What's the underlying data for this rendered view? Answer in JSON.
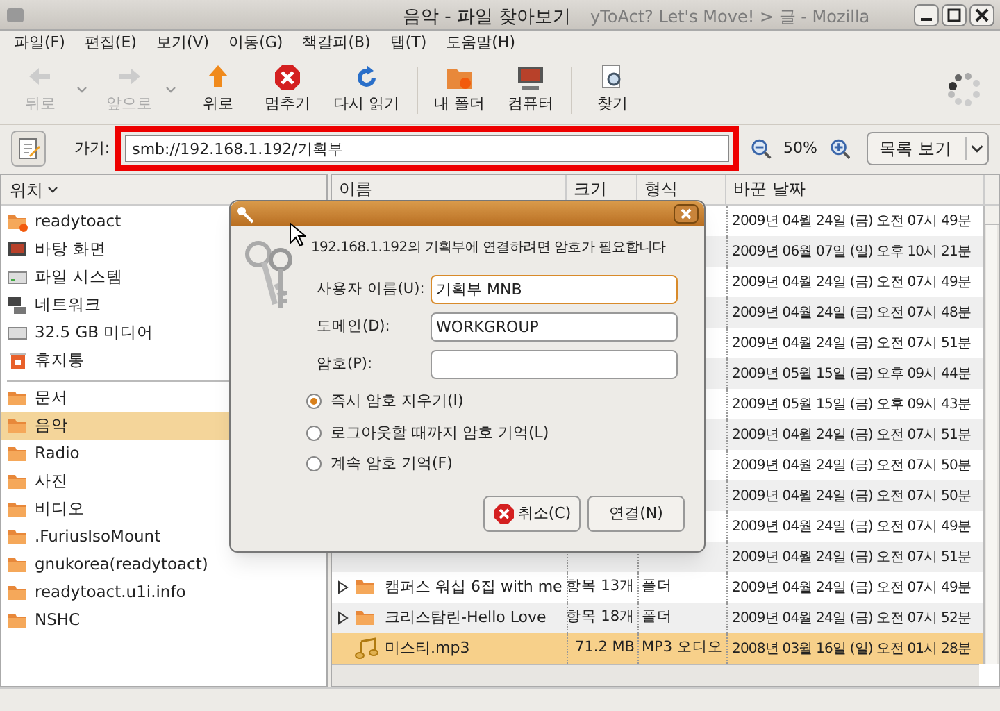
{
  "window": {
    "title": "음악 - 파일 찾아보기",
    "background_title": "yToAct? Let's Move! > 글 - Mozilla"
  },
  "menu": [
    "파일(F)",
    "편집(E)",
    "보기(V)",
    "이동(G)",
    "책갈피(B)",
    "탭(T)",
    "도움말(H)"
  ],
  "toolbar": [
    {
      "label": "뒤로",
      "disabled": true,
      "dropdown": true
    },
    {
      "label": "앞으로",
      "disabled": true,
      "dropdown": true
    },
    {
      "label": "위로",
      "disabled": false,
      "dropdown": false
    },
    {
      "label": "멈추기",
      "disabled": false,
      "dropdown": false
    },
    {
      "label": "다시 읽기",
      "disabled": false,
      "dropdown": false
    },
    {
      "label": "내 폴더",
      "disabled": false,
      "dropdown": false
    },
    {
      "label": "컴퓨터",
      "disabled": false,
      "dropdown": false
    },
    {
      "label": "찾기",
      "disabled": false,
      "dropdown": false
    }
  ],
  "location": {
    "label": "가기:",
    "value": "smb://192.168.1.192/기획부",
    "zoom": "50%",
    "view": "목록 보기"
  },
  "sidebar": {
    "title": "위치",
    "places": [
      {
        "label": "readytoact",
        "selected": false
      },
      {
        "label": "바탕 화면",
        "selected": false
      },
      {
        "label": "파일 시스템",
        "selected": false
      },
      {
        "label": "네트워크",
        "selected": false
      },
      {
        "label": "32.5 GB 미디어",
        "selected": false
      },
      {
        "label": "휴지통",
        "selected": false
      }
    ],
    "bookmarks": [
      {
        "label": "문서",
        "selected": false
      },
      {
        "label": "음악",
        "selected": true
      },
      {
        "label": "Radio",
        "selected": false
      },
      {
        "label": "사진",
        "selected": false
      },
      {
        "label": "비디오",
        "selected": false
      },
      {
        "label": ".FuriusIsoMount",
        "selected": false
      },
      {
        "label": "gnukorea(readytoact)",
        "selected": false
      },
      {
        "label": "readytoact.u1i.info",
        "selected": false
      },
      {
        "label": "NSHC",
        "selected": false
      }
    ]
  },
  "files": {
    "columns": [
      "이름",
      "크기",
      "형식",
      "바꾼 날짜"
    ],
    "rows": [
      {
        "date": "2009년 04월 24일 (금) 오전 07시 49분",
        "selected": false
      },
      {
        "date": "2009년 06월 07일 (일) 오후 10시 21분",
        "selected": false
      },
      {
        "date": "2009년 04월 24일 (금) 오전 07시 49분",
        "selected": false
      },
      {
        "date": "2009년 04월 24일 (금) 오전 07시 48분",
        "selected": false
      },
      {
        "date": "2009년 04월 24일 (금) 오전 07시 51분",
        "selected": false
      },
      {
        "date": "2009년 05월 15일 (금) 오후 09시 44분",
        "selected": false
      },
      {
        "date": "2009년 05월 15일 (금) 오후 09시 43분",
        "selected": false
      },
      {
        "date": "2009년 04월 24일 (금) 오전 07시 51분",
        "selected": false
      },
      {
        "date": "2009년 04월 24일 (금) 오전 07시 50분",
        "selected": false
      },
      {
        "date": "2009년 04월 24일 (금) 오전 07시 50분",
        "selected": false
      },
      {
        "date": "2009년 04월 24일 (금) 오전 07시 49분",
        "selected": false
      },
      {
        "date": "2009년 04월 24일 (금) 오전 07시 51분",
        "selected": false
      },
      {
        "kind": "folder",
        "name": "캠퍼스 워십 6집 with me",
        "size": "항목 13개",
        "type": "폴더",
        "date": "2009년 04월 24일 (금) 오전 07시 49분",
        "selected": false
      },
      {
        "kind": "folder",
        "name": "크리스탐린-Hello Love",
        "size": "항목 18개",
        "type": "폴더",
        "date": "2009년 04월 24일 (금) 오전 07시 52분",
        "selected": false
      },
      {
        "kind": "audio",
        "name": "미스티.mp3",
        "size": "71.2 MB",
        "type": "MP3 오디오",
        "date": "2008년 03월 16일 (일) 오전 01시 28분",
        "selected": true
      }
    ]
  },
  "dialog": {
    "message": "192.168.1.192의 기획부에 연결하려면 암호가 필요합니다",
    "fields": [
      {
        "label": "사용자 이름(U):",
        "value": "기획부 MNB",
        "focused": true
      },
      {
        "label": "도메인(D):",
        "value": "WORKGROUP",
        "focused": false
      },
      {
        "label": "암호(P):",
        "focused": false
      }
    ],
    "options": [
      {
        "label": "즉시 암호 지우기(I)",
        "selected": true
      },
      {
        "label": "로그아웃할 때까지 암호 기억(L)",
        "selected": false
      },
      {
        "label": "계속 암호 기억(F)",
        "selected": false
      }
    ],
    "buttons": [
      "취소(C)",
      "연결(N)"
    ]
  }
}
